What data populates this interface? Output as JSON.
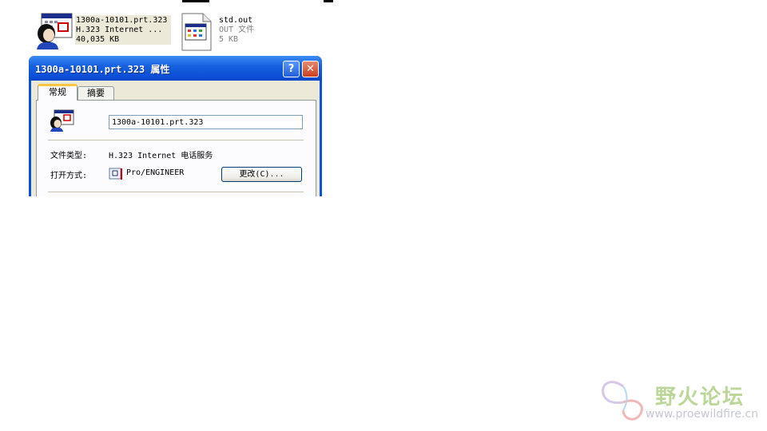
{
  "files": [
    {
      "name": "1300a-10101.prt.323",
      "type": "H.323 Internet ...",
      "size": "40,035 KB",
      "icon": "netmeeting-person-icon"
    },
    {
      "name": "std.out",
      "type": "OUT 文件",
      "size": "5 KB",
      "icon": "generic-document-icon"
    }
  ],
  "dialog": {
    "title": "1300a-10101.prt.323 属性",
    "help_label": "?",
    "close_label": "✕",
    "tabs": [
      "常规",
      "摘要"
    ],
    "filename": "1300a-10101.prt.323",
    "file_type_label": "文件类型:",
    "file_type_value": "H.323 Internet 电话服务",
    "open_with_label": "打开方式:",
    "open_with_value": "Pro/ENGINEER",
    "change_button": "更改(C)..."
  },
  "watermark": {
    "title": "野火论坛",
    "url": "www.proewildfire.cn"
  },
  "colors": {
    "titlebar": "#0a53d8",
    "face": "#ece9d8",
    "close": "#c8401f",
    "accent_tab": "#ffc83c"
  }
}
